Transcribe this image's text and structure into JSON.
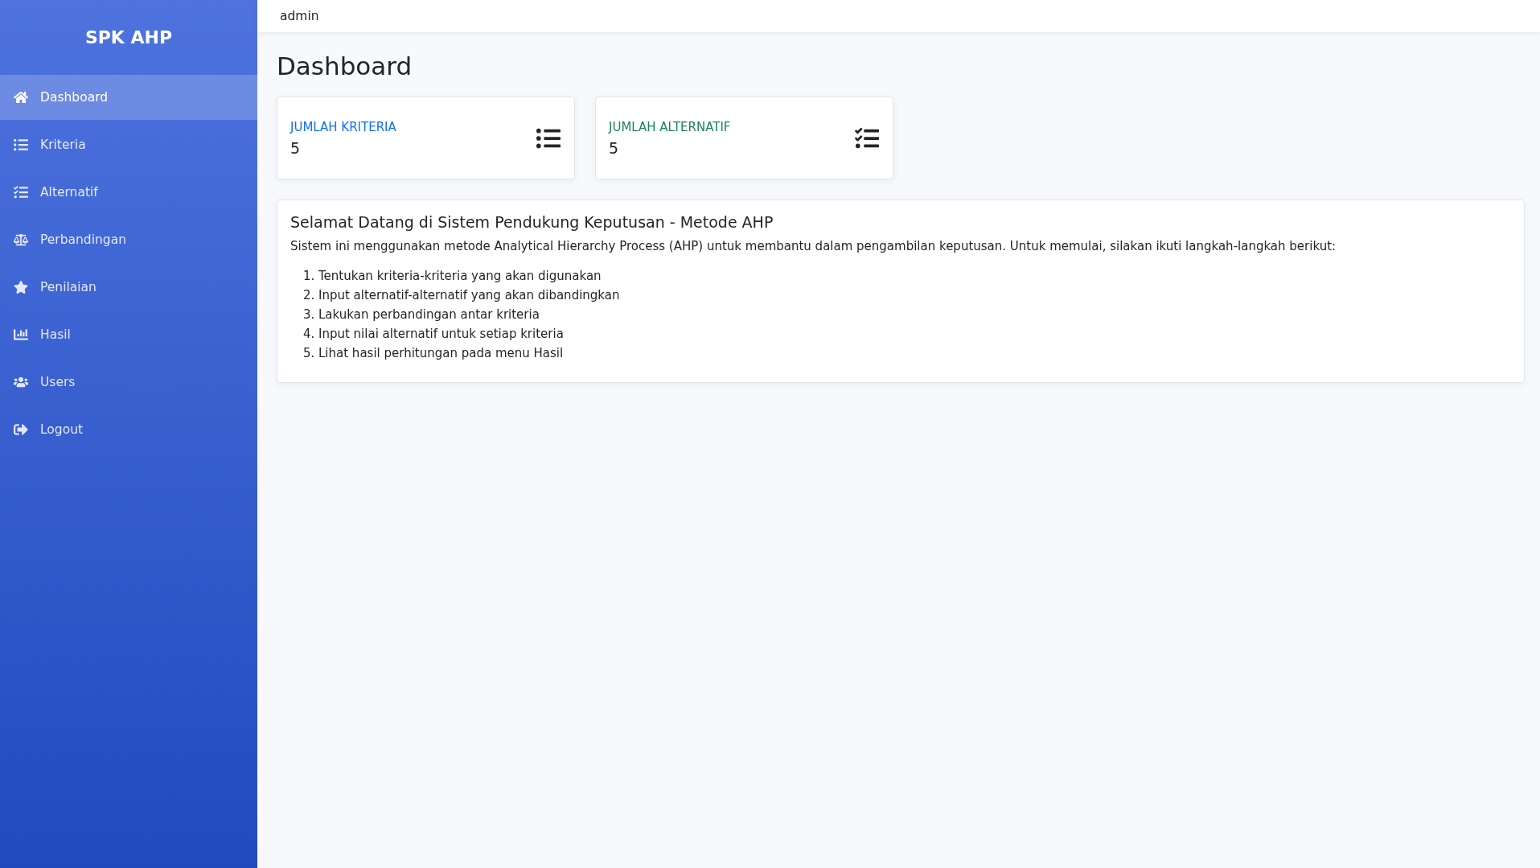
{
  "sidebar": {
    "brand": "SPK AHP",
    "items": [
      {
        "label": "Dashboard",
        "selected": true
      },
      {
        "label": "Kriteria",
        "selected": false
      },
      {
        "label": "Alternatif",
        "selected": false
      },
      {
        "label": "Perbandingan",
        "selected": false
      },
      {
        "label": "Penilaian",
        "selected": false
      },
      {
        "label": "Hasil",
        "selected": false
      },
      {
        "label": "Users",
        "selected": false
      },
      {
        "label": "Logout",
        "selected": false
      }
    ]
  },
  "topbar": {
    "user": "admin"
  },
  "page_title": "Dashboard",
  "stats": [
    {
      "label": "JUMLAH KRITERIA",
      "value": "5",
      "color": "#0d6efd"
    },
    {
      "label": "JUMLAH ALTERNATIF",
      "value": "5",
      "color": "#198754"
    }
  ],
  "welcome": {
    "title": "Selamat Datang di Sistem Pendukung Keputusan - Metode AHP",
    "intro": "Sistem ini menggunakan metode Analytical Hierarchy Process (AHP) untuk membantu dalam pengambilan keputusan. Untuk memulai, silakan ikuti langkah-langkah berikut:",
    "steps": [
      {
        "number": "1.",
        "text": "Tentukan kriteria-kriteria yang akan digunakan"
      },
      {
        "number": "2.",
        "text": "Input alternatif-alternatif yang akan dibandingkan"
      },
      {
        "number": "3.",
        "text": "Lakukan perbandingan antar kriteria"
      },
      {
        "number": "4.",
        "text": "Input nilai alternatif untuk setiap kriteria"
      },
      {
        "number": "5.",
        "text": "Lihat hasil perhitungan pada menu Hasil"
      }
    ]
  }
}
